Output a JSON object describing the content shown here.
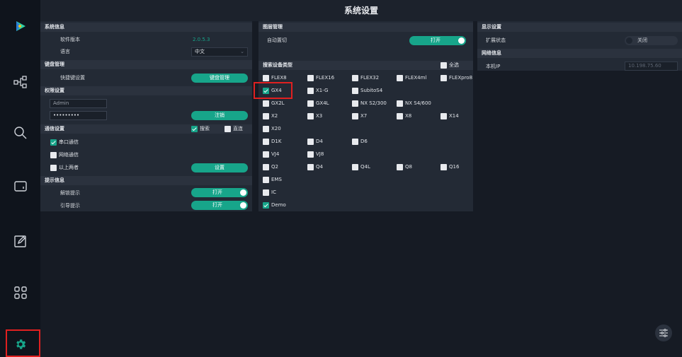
{
  "window": {
    "title": "系统设置"
  },
  "sidebar": {
    "icons": [
      "play-logo-icon",
      "topology-icon",
      "search-icon",
      "screen-icon",
      "edit-icon",
      "grid-icon",
      "gear-icon"
    ]
  },
  "left": {
    "sys_info": {
      "header": "系统信息",
      "version_label": "软件版本",
      "version_value": "2.0.5.3",
      "lang_label": "语言",
      "lang_value": "中文"
    },
    "keyboard": {
      "header": "键盘管理",
      "shortcut_label": "快捷键设置",
      "button": "键盘管理"
    },
    "permission": {
      "header": "权限设置",
      "user": "Admin",
      "password": "•••••••••",
      "logout": "注销"
    },
    "comm": {
      "header": "通信设置",
      "search": "搜索",
      "direct": "直连",
      "serial": "串口通信",
      "network": "网络通信",
      "both": "以上两者",
      "set_button": "设置"
    },
    "tips": {
      "header": "提示信息",
      "unlock_label": "解锁提示",
      "unlock_state": "打开",
      "guide_label": "引导提示",
      "guide_state": "打开"
    }
  },
  "middle": {
    "layer": {
      "header": "图层管理",
      "auto_label": "自动置切",
      "auto_state": "打开"
    },
    "search_types": {
      "header": "搜索设备类型",
      "select_all": "全选",
      "rows": [
        [
          "FLEX8",
          "FLEX16",
          "FLEX32",
          "FLEX4ml",
          "FLEXpro8"
        ],
        [
          "GX4",
          "X1-G",
          "SubitoS4"
        ],
        [
          "GX2L",
          "GX4L",
          "NX S2/300",
          "NX S4/600"
        ],
        [
          "X2",
          "X3",
          "X7",
          "X8",
          "X14"
        ],
        [
          "X20"
        ],
        [
          "D1K",
          "D4",
          "D6"
        ],
        [
          "VJ4",
          "VJ8"
        ],
        [
          "Q2",
          "Q4",
          "Q4L",
          "Q8",
          "Q16"
        ],
        [
          "EMS"
        ],
        [
          "IC"
        ],
        [
          "Demo"
        ]
      ]
    }
  },
  "right": {
    "display": {
      "header": "显示设置",
      "extend_label": "扩展状态",
      "extend_state": "关闭"
    },
    "network": {
      "header": "网络信息",
      "ip_label": "本机IP",
      "ip_value": "10.198.75.60"
    }
  },
  "colors": {
    "accent": "#17a58a",
    "highlight": "#e02020"
  }
}
